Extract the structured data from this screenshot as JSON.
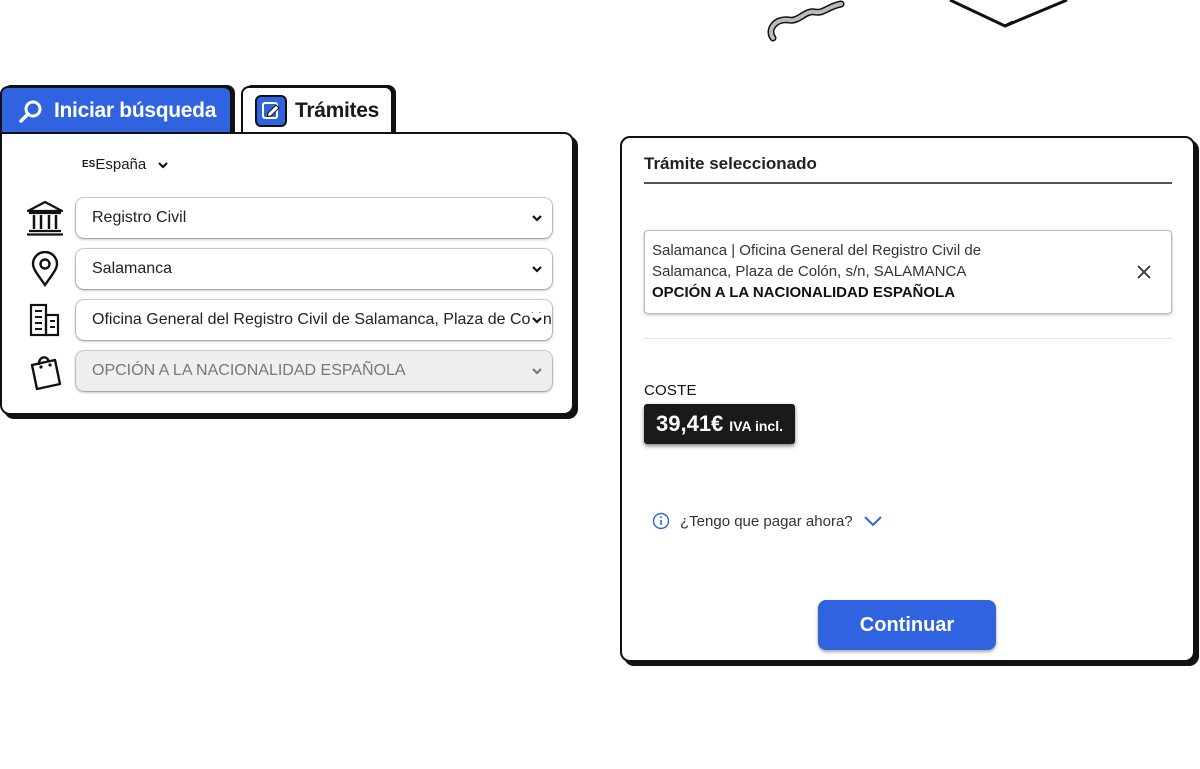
{
  "tabs": {
    "search_label": "Iniciar búsqueda",
    "tramites_label": "Trámites"
  },
  "country": {
    "code": "ES",
    "name": "España"
  },
  "filters": {
    "category": "Registro Civil",
    "city": "Salamanca",
    "office": "Oficina General del Registro Civil de Salamanca, Plaza de Colón, s/n, SALAMANCA",
    "procedure": "OPCIÓN A LA NACIONALIDAD ESPAÑOLA"
  },
  "selected": {
    "title": "Trámite seleccionado",
    "location_line1": "Salamanca | Oficina General del Registro Civil de",
    "location_line2": "Salamanca, Plaza de Colón, s/n, SALAMANCA",
    "procedure": "OPCIÓN A LA NACIONALIDAD ESPAÑOLA"
  },
  "cost": {
    "label": "COSTE",
    "amount": "39,41€",
    "vat": "IVA incl."
  },
  "faq": {
    "question": "¿Tengo que pagar ahora?"
  },
  "actions": {
    "continue_label": "Continuar"
  },
  "colors": {
    "accent": "#2f63e0",
    "dark": "#1a1a1a"
  }
}
